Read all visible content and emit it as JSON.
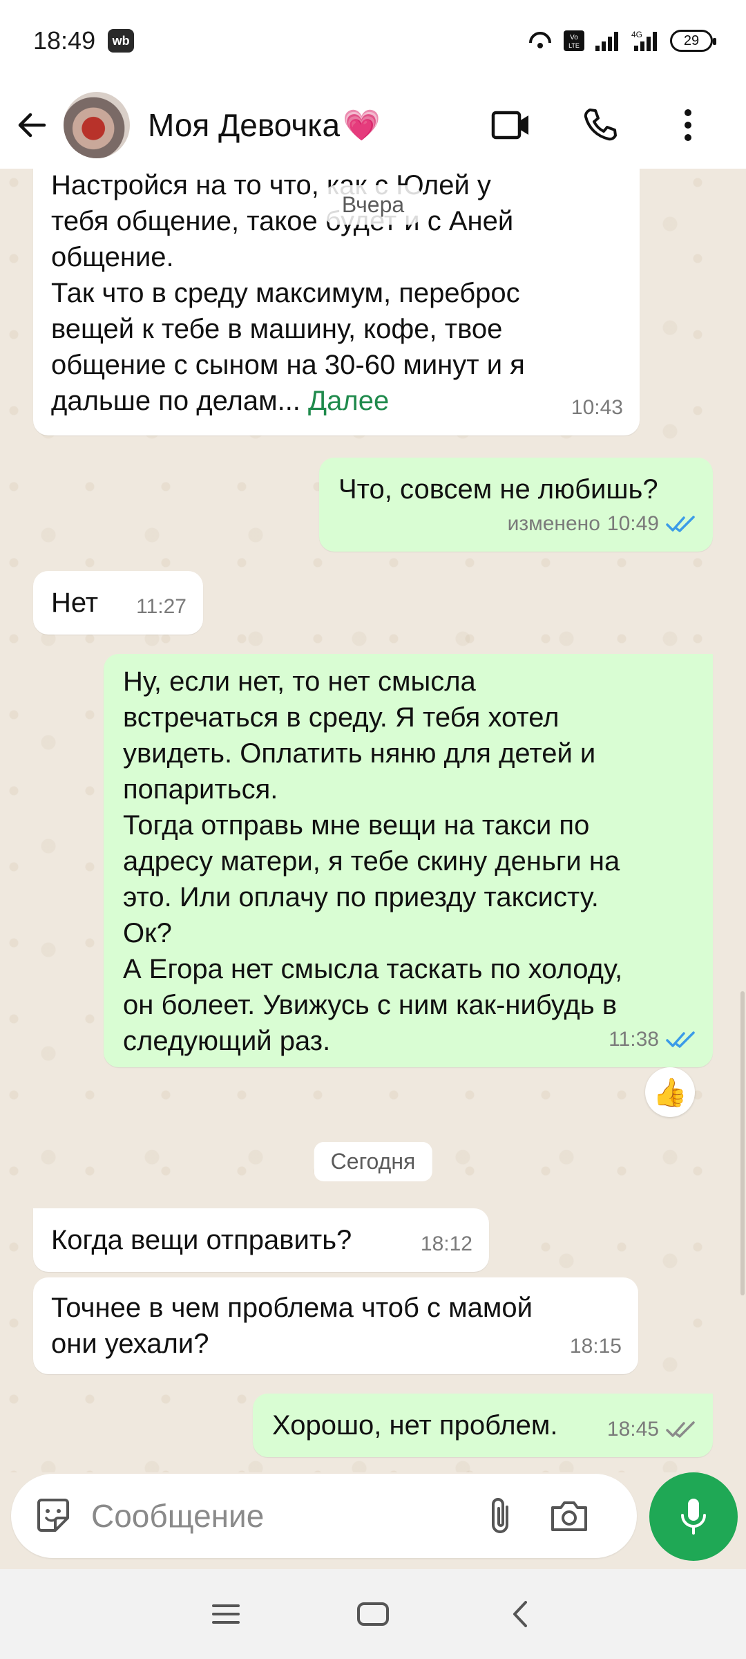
{
  "status_bar": {
    "time": "18:49",
    "app_badge": "wb",
    "battery": "29",
    "network": "4G"
  },
  "header": {
    "contact_name": "Моя Девочка",
    "heart": "💗"
  },
  "chat": {
    "floating_date": "Вчера",
    "today_label": "Сегодня",
    "messages": [
      {
        "dir": "in",
        "text": "Настройся на то что, как с Юлей у\nтебя общение, такое будет и с Аней\nобщение.\nТак что в среду максимум, переброс\nвещей к тебе в машину, кофе, твое\nобщение с сыном на 30-60 минут и я\nдальше по делам...",
        "more": "Далее",
        "time": "10:43"
      },
      {
        "dir": "out",
        "text": "Что, совсем не любишь?",
        "edited": "изменено",
        "time": "10:49",
        "status": "read"
      },
      {
        "dir": "in",
        "text": "Нет",
        "time": "11:27"
      },
      {
        "dir": "out",
        "text": "Ну, если нет, то нет смысла\nвстречаться в среду. Я тебя хотел\nувидеть. Оплатить няню для детей и\nпопариться.\nТогда отправь мне вещи на такси по\nадресу матери, я тебе скину деньги на\nэто. Или оплачу по приезду таксисту.\nОк?\nА Егора нет смысла таскать по холоду,\nон болеет. Увижусь с ним как-нибудь в\nследующий раз.",
        "time": "11:38",
        "status": "read",
        "reaction": "👍"
      },
      {
        "dir": "in",
        "text": "Когда вещи отправить?",
        "time": "18:12"
      },
      {
        "dir": "in",
        "text": "Точнее в чем проблема чтоб с мамой\nони уехали?",
        "time": "18:15"
      },
      {
        "dir": "out",
        "text": "Хорошо, нет проблем.",
        "time": "18:45",
        "status": "delivered"
      }
    ]
  },
  "composer": {
    "placeholder": "Сообщение"
  },
  "colors": {
    "incoming": "#ffffff",
    "outgoing": "#d9fdd3",
    "accent": "#1fa855",
    "read_tick": "#3b9be8",
    "link": "#1f8a4c"
  }
}
